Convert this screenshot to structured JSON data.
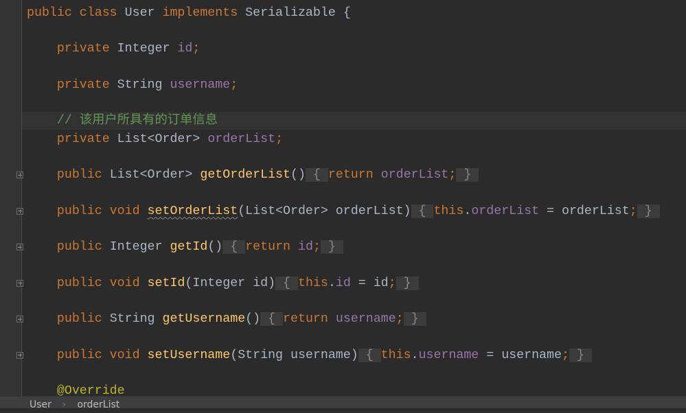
{
  "editor": {
    "current_line": 6,
    "lines": [
      [
        [
          "public class ",
          "kw"
        ],
        [
          "User ",
          ""
        ],
        [
          "implements ",
          "kw"
        ],
        [
          "Serializable {",
          ""
        ]
      ],
      [],
      [
        [
          "    private ",
          "kw"
        ],
        [
          "Integer ",
          ""
        ],
        [
          "id",
          "fd"
        ],
        [
          ";",
          "kw"
        ]
      ],
      [],
      [
        [
          "    private ",
          "kw"
        ],
        [
          "String ",
          ""
        ],
        [
          "username",
          "fd"
        ],
        [
          ";",
          "kw"
        ]
      ],
      [],
      [
        [
          "    // 该用户所具有的订单信息",
          "cm"
        ]
      ],
      [
        [
          "    private ",
          "kw"
        ],
        [
          "List<Order> ",
          ""
        ],
        [
          "orderList",
          "fd"
        ],
        [
          ";",
          "kw"
        ]
      ],
      [],
      [
        [
          "    public ",
          "kw"
        ],
        [
          "List<Order> ",
          ""
        ],
        [
          "getOrderList",
          "fn"
        ],
        [
          "()",
          ""
        ],
        [
          " { ",
          "fold"
        ],
        [
          "return ",
          "kw"
        ],
        [
          "orderList",
          "fd"
        ],
        [
          ";",
          "kw"
        ],
        [
          " } ",
          "fold"
        ]
      ],
      [],
      [
        [
          "    public void ",
          "kw"
        ],
        [
          "setOrderList",
          "fn warn"
        ],
        [
          "(List<Order> orderList)",
          ""
        ],
        [
          " { ",
          "fold"
        ],
        [
          "this",
          "kw"
        ],
        [
          ".",
          ""
        ],
        [
          "orderList",
          "fd"
        ],
        [
          " = orderList",
          ""
        ],
        [
          ";",
          "kw"
        ],
        [
          " } ",
          "fold"
        ]
      ],
      [],
      [
        [
          "    public ",
          "kw"
        ],
        [
          "Integer ",
          ""
        ],
        [
          "getId",
          "fn"
        ],
        [
          "()",
          ""
        ],
        [
          " { ",
          "fold"
        ],
        [
          "return ",
          "kw"
        ],
        [
          "id",
          "fd"
        ],
        [
          ";",
          "kw"
        ],
        [
          " } ",
          "fold"
        ]
      ],
      [],
      [
        [
          "    public void ",
          "kw"
        ],
        [
          "setId",
          "fn"
        ],
        [
          "(Integer id)",
          ""
        ],
        [
          " { ",
          "fold"
        ],
        [
          "this",
          "kw"
        ],
        [
          ".",
          ""
        ],
        [
          "id",
          "fd"
        ],
        [
          " = id",
          ""
        ],
        [
          ";",
          "kw"
        ],
        [
          " } ",
          "fold"
        ]
      ],
      [],
      [
        [
          "    public ",
          "kw"
        ],
        [
          "String ",
          ""
        ],
        [
          "getUsername",
          "fn"
        ],
        [
          "()",
          ""
        ],
        [
          " { ",
          "fold"
        ],
        [
          "return ",
          "kw"
        ],
        [
          "username",
          "fd"
        ],
        [
          ";",
          "kw"
        ],
        [
          " } ",
          "fold"
        ]
      ],
      [],
      [
        [
          "    public void ",
          "kw"
        ],
        [
          "setUsername",
          "fn"
        ],
        [
          "(String username)",
          ""
        ],
        [
          " { ",
          "fold"
        ],
        [
          "this",
          "kw"
        ],
        [
          ".",
          ""
        ],
        [
          "username",
          "fd"
        ],
        [
          " = username",
          ""
        ],
        [
          ";",
          "kw"
        ],
        [
          " } ",
          "fold"
        ]
      ],
      [],
      [
        [
          "    @Override",
          "an"
        ]
      ]
    ],
    "fold_lines": [
      9,
      11,
      13,
      15,
      17,
      19
    ]
  },
  "breadcrumb": {
    "items": [
      "User",
      "orderList"
    ],
    "separator": "›"
  }
}
